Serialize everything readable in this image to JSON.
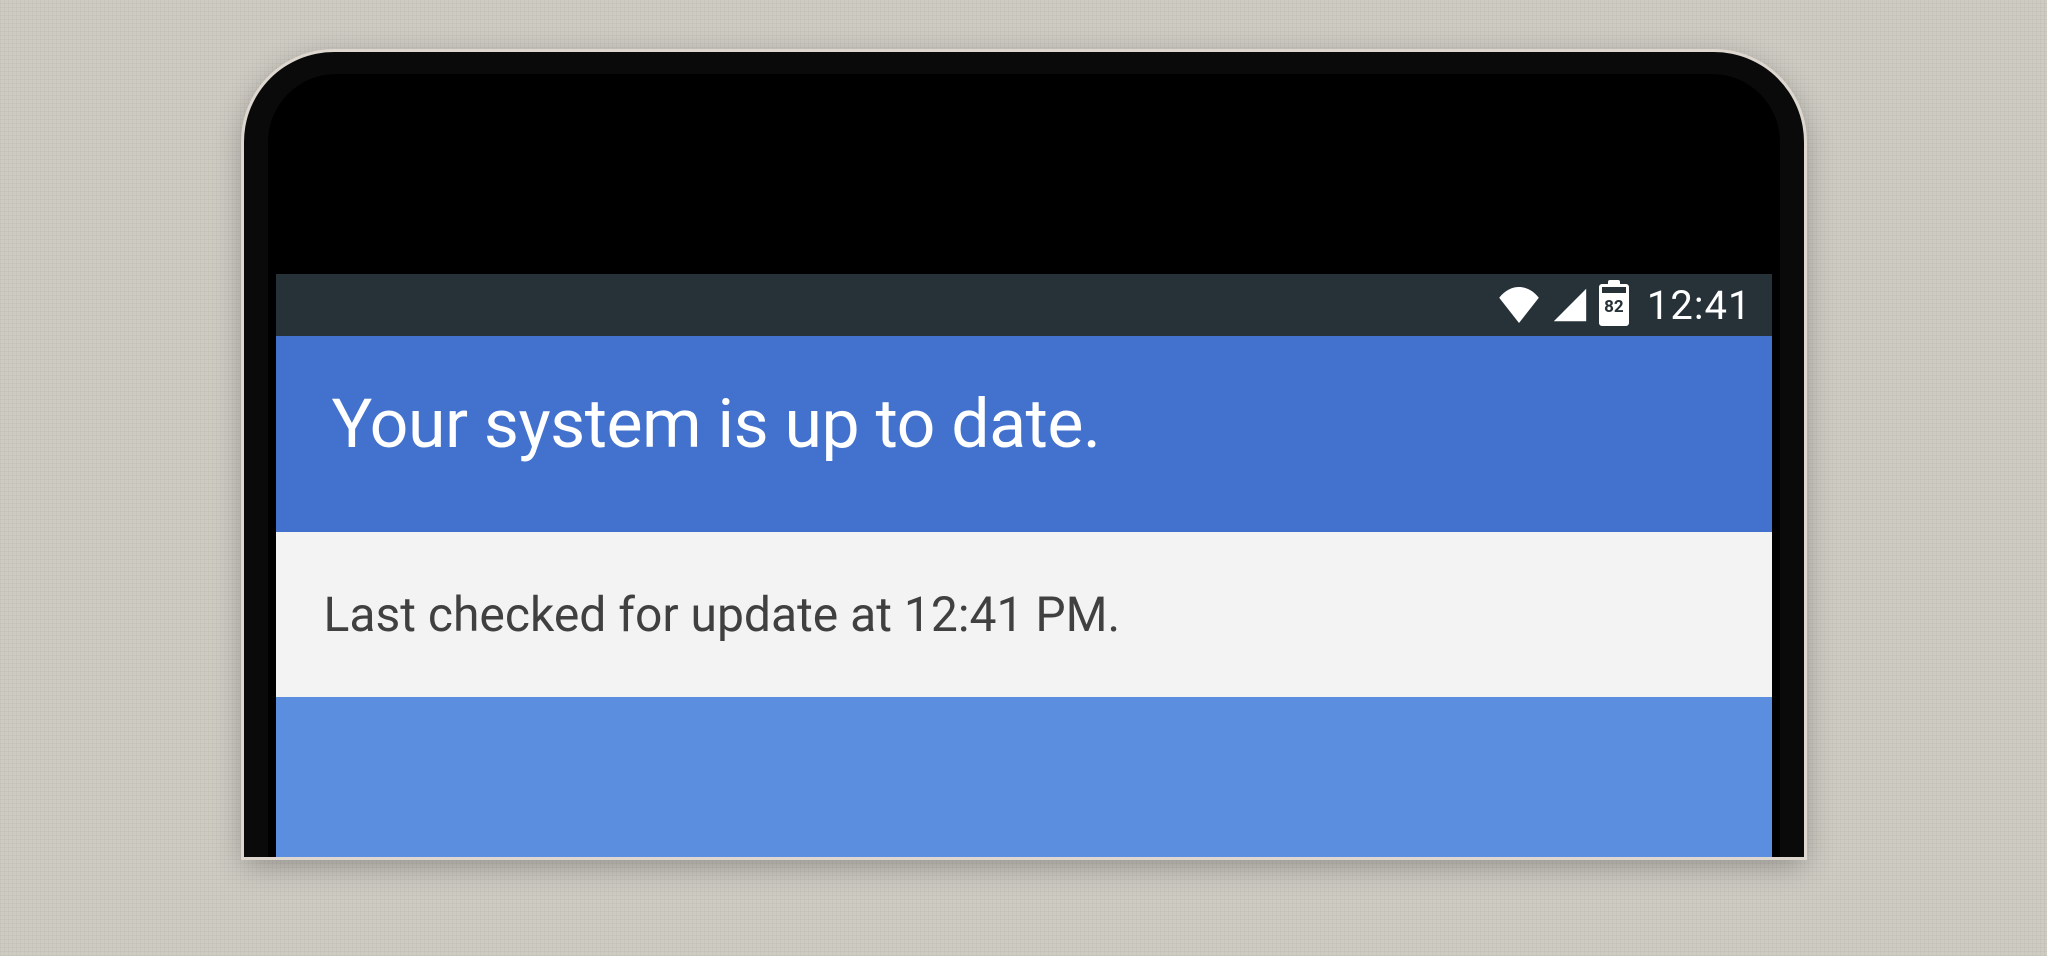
{
  "status_bar": {
    "clock": "12:41",
    "battery_level": "82"
  },
  "header": {
    "title": "Your system is up to date."
  },
  "card": {
    "last_checked": "Last checked for update at 12:41 PM."
  }
}
